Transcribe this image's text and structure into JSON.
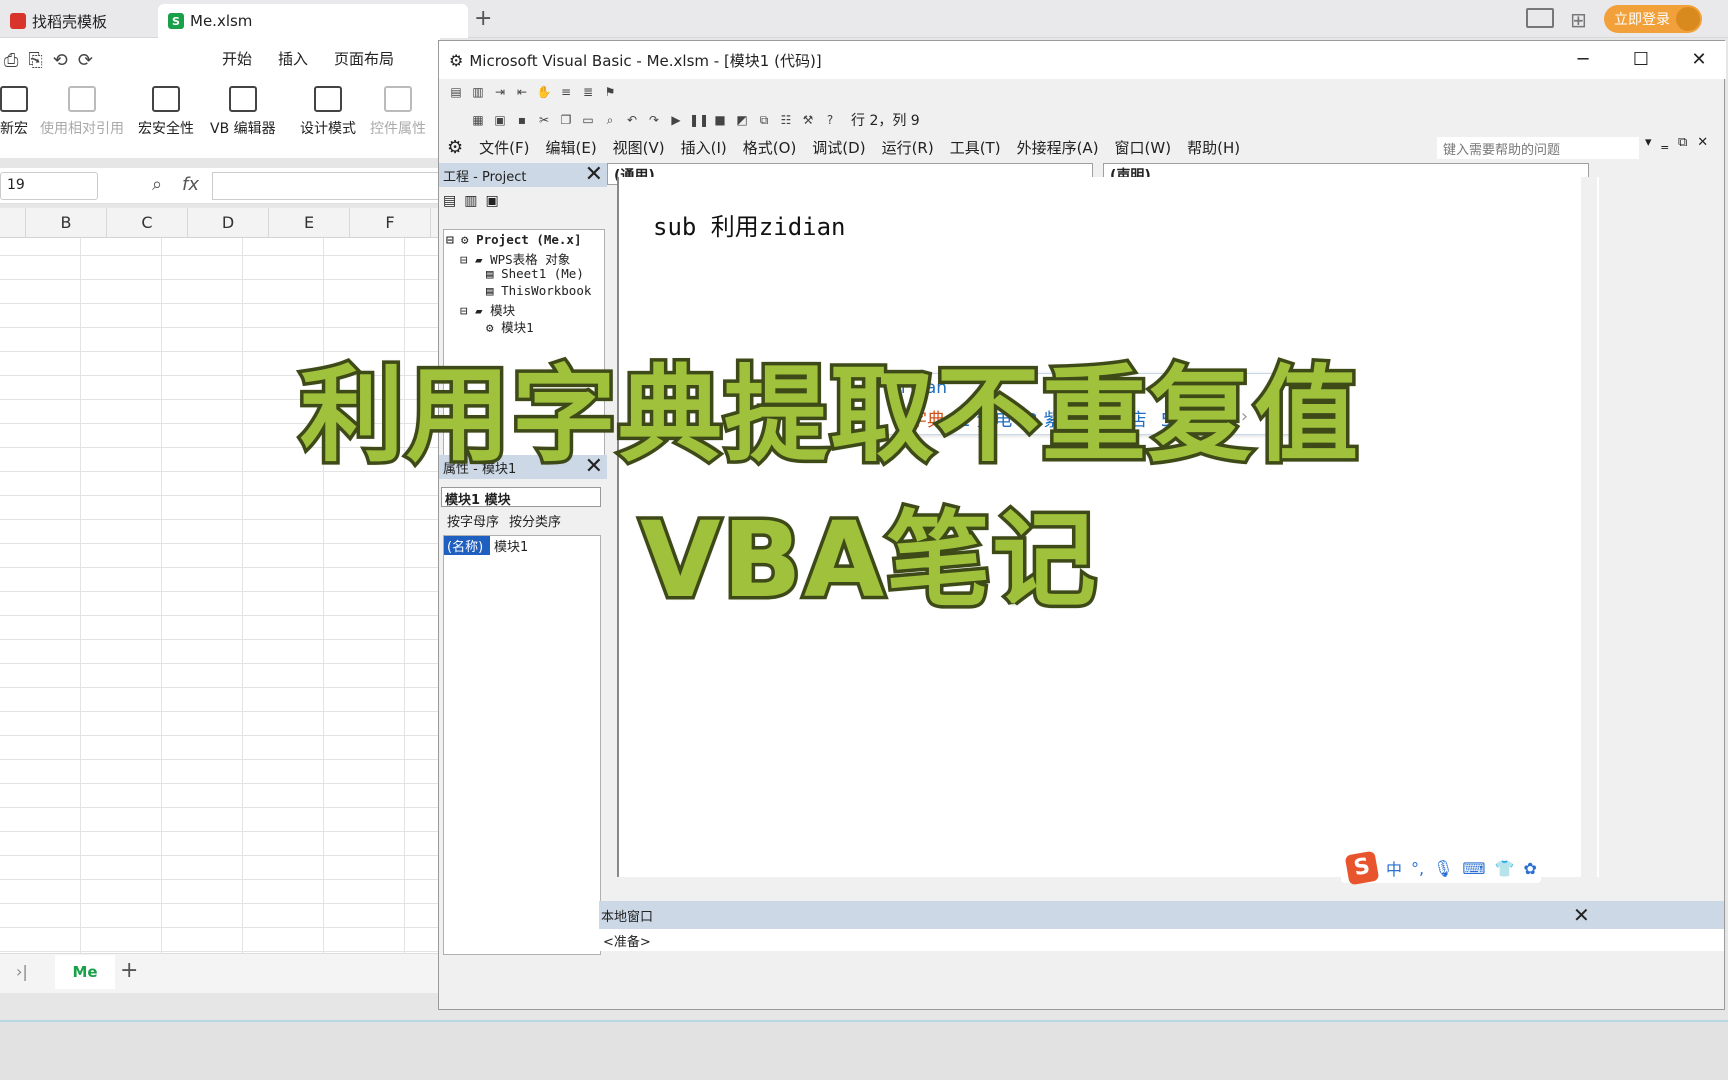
{
  "browser_tabs": {
    "tab1": "找稻壳模板",
    "tab2": "Me.xlsm",
    "login": "立即登录"
  },
  "wps": {
    "menus": [
      "开始",
      "插入",
      "页面布局"
    ],
    "ribbon": {
      "new_macro": "新宏",
      "relative_ref": "使用相对引用",
      "macro_security": "宏安全性",
      "vb_editor": "VB 编辑器",
      "design_mode": "设计模式",
      "control_props": "控件属性"
    },
    "namebox": "19",
    "fx": "fx",
    "columns": [
      "B",
      "C",
      "D",
      "E",
      "F"
    ],
    "sheet_tab": "Me",
    "add_sheet": "+"
  },
  "vbe": {
    "title": "Microsoft Visual Basic - Me.xlsm - [模块1 (代码)]",
    "cursor_pos": "行 2，列 9",
    "menu": [
      "文件(F)",
      "编辑(E)",
      "视图(V)",
      "插入(I)",
      "格式(O)",
      "调试(D)",
      "运行(R)",
      "工具(T)",
      "外接程序(A)",
      "窗口(W)",
      "帮助(H)"
    ],
    "help_placeholder": "键入需要帮助的问题",
    "project_title": "工程 - Project",
    "tree": [
      "Project (Me.x]",
      "WPS表格 对象",
      "Sheet1 (Me)",
      "ThisWorkbook",
      "模块",
      "模块1"
    ],
    "props_title": "属性 - 模块1",
    "props_select": "模块1 模块",
    "props_tabs": [
      "按字母序",
      "按分类序"
    ],
    "prop_name_key": "(名称)",
    "prop_name_val": "模块1",
    "combo_general": "(通用)",
    "combo_decl": "(声明)",
    "code_text": "sub 利用zidian",
    "local_window": "本地窗口",
    "ready": "<准备>"
  },
  "ime": {
    "pinyin": "zi'dian",
    "candidates": [
      "1 字典",
      "2 紫电",
      "3 紫癜",
      "4 自店",
      "5 自点"
    ]
  },
  "sogou": {
    "lang": "中",
    "punct": "°,"
  },
  "overlay": {
    "line1": "利用字典提取不重复值",
    "line2": "VBA笔记"
  }
}
